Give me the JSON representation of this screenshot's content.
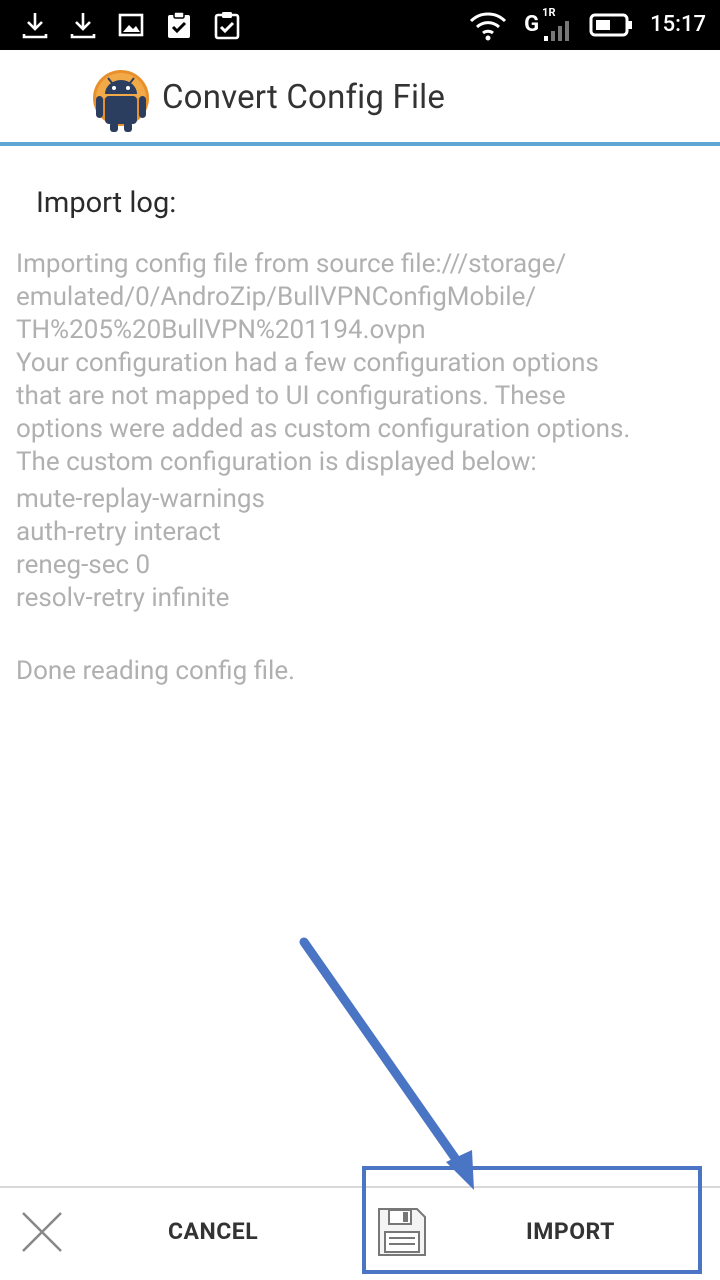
{
  "status_bar": {
    "time": "15:17",
    "network_label": "G",
    "sim_label": "1R",
    "icons": [
      "download-icon",
      "download-icon",
      "image-icon",
      "clipboard-check-icon",
      "clipboard-check-icon"
    ]
  },
  "app_bar": {
    "title": "Convert Config File"
  },
  "log": {
    "label": "Import log:",
    "lines": [
      "Importing config file from source file:///storage/",
      "emulated/0/AndroZip/BullVPNConfigMobile/",
      "TH%205%20BullVPN%201194.ovpn",
      "Your configuration had a few configuration options",
      "that are not mapped to UI configurations. These",
      "options were added as custom configuration options.",
      "The custom configuration is displayed below:",
      "mute-replay-warnings",
      "auth-retry interact",
      "reneg-sec 0",
      "resolv-retry infinite",
      "Done reading config file."
    ]
  },
  "actions": {
    "cancel_label": "CANCEL",
    "import_label": "IMPORT"
  },
  "colors": {
    "accent_line": "#5fa6d6",
    "annotation": "#4a74c4",
    "log_text": "#b0b0b0"
  }
}
